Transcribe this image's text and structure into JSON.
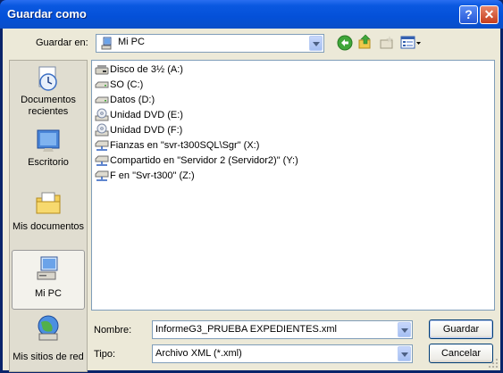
{
  "window": {
    "title": "Guardar como"
  },
  "toolbar": {
    "save_in_label": "Guardar en:",
    "location_value": "Mi PC",
    "back_icon": "back-arrow-icon",
    "up_icon": "up-folder-icon",
    "new_folder_icon": "new-folder-icon",
    "views_icon": "views-menu-icon"
  },
  "places": [
    {
      "label": "Documentos recientes",
      "icon": "recent-documents-icon"
    },
    {
      "label": "Escritorio",
      "icon": "desktop-icon"
    },
    {
      "label": "Mis documentos",
      "icon": "my-documents-icon"
    },
    {
      "label": "Mi PC",
      "icon": "my-computer-icon"
    },
    {
      "label": "Mis sitios de red",
      "icon": "network-places-icon"
    }
  ],
  "files": [
    {
      "name": "Disco de 3½ (A:)",
      "icon": "floppy-drive-icon"
    },
    {
      "name": "SO (C:)",
      "icon": "hard-drive-icon"
    },
    {
      "name": "Datos (D:)",
      "icon": "hard-drive-icon"
    },
    {
      "name": "Unidad DVD (E:)",
      "icon": "dvd-drive-icon"
    },
    {
      "name": "Unidad DVD (F:)",
      "icon": "dvd-drive-icon"
    },
    {
      "name": "Fianzas en \"svr-t300SQL\\Sgr\" (X:)",
      "icon": "network-drive-icon"
    },
    {
      "name": "Compartido en \"Servidor 2 (Servidor2)\" (Y:)",
      "icon": "network-drive-icon"
    },
    {
      "name": "F en \"Svr-t300\" (Z:)",
      "icon": "network-drive-icon"
    }
  ],
  "form": {
    "name_label": "Nombre:",
    "name_value": "InformeG3_PRUEBA EXPEDIENTES.xml",
    "type_label": "Tipo:",
    "type_value": "Archivo XML (*.xml)",
    "save_button": "Guardar",
    "cancel_button": "Cancelar"
  },
  "colors": {
    "titlebar": "#0450d8",
    "client": "#ece9d8",
    "border": "#7f9db9"
  }
}
